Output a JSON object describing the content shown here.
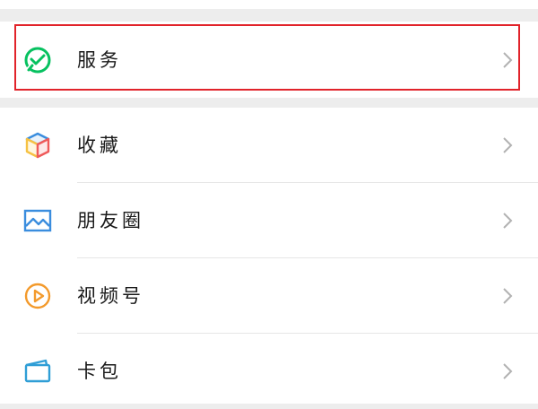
{
  "menu": {
    "groups": [
      {
        "items": [
          {
            "label": "服务",
            "icon": "wechat-pay-check-icon"
          }
        ]
      },
      {
        "items": [
          {
            "label": "收藏",
            "icon": "favorites-cube-icon"
          },
          {
            "label": "朋友圈",
            "icon": "moments-picture-icon"
          },
          {
            "label": "视频号",
            "icon": "channels-play-icon"
          },
          {
            "label": "卡包",
            "icon": "card-wallet-icon"
          }
        ]
      }
    ]
  },
  "colors": {
    "background": "#ededed",
    "row_background": "#ffffff",
    "highlight_border": "#e1232a",
    "service_green": "#07c160",
    "favorites_blue": "#3a8dde",
    "favorites_yellow": "#f6c244",
    "favorites_red": "#ef5a5a",
    "moments_blue": "#3a8dde",
    "channels_orange": "#f39a2c",
    "card_teal": "#2f9ed6",
    "chevron": "#b2b2b2"
  }
}
